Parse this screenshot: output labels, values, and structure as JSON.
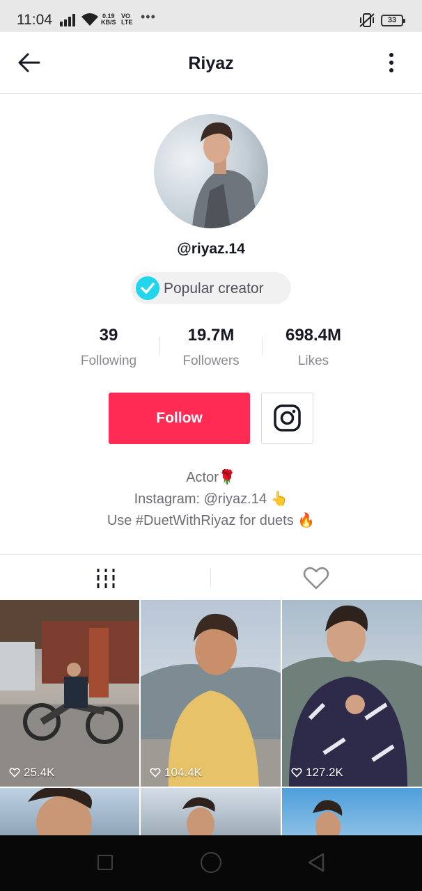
{
  "status_bar": {
    "time": "11:04",
    "speed_value": "0.19",
    "speed_unit": "KB/S",
    "volte_top": "VO",
    "volte_bottom": "LTE",
    "overflow": "•••",
    "battery": "33",
    "icons": [
      "signal-icon",
      "wifi-icon",
      "vibrate-icon",
      "battery-icon"
    ]
  },
  "header": {
    "title": "Riyaz",
    "icons": [
      "back-arrow-icon",
      "more-vertical-icon"
    ]
  },
  "profile": {
    "username": "@riyaz.14",
    "badge_label": "Popular creator",
    "stats": [
      {
        "value": "39",
        "label": "Following"
      },
      {
        "value": "19.7M",
        "label": "Followers"
      },
      {
        "value": "698.4M",
        "label": "Likes"
      }
    ],
    "follow_label": "Follow",
    "bio_lines": [
      {
        "text": "Actor",
        "emoji": "🌹"
      },
      {
        "text": "Instagram: @riyaz.14",
        "emoji": "👆"
      },
      {
        "text": "Use #DuetWithRiyaz for duets",
        "emoji": "🔥"
      }
    ]
  },
  "tabs": {
    "icons": [
      "videos-grid-icon",
      "liked-heart-icon"
    ]
  },
  "videos": [
    {
      "views": "25.4K"
    },
    {
      "views": "104.4K"
    },
    {
      "views": "127.2K"
    },
    {
      "views": ""
    },
    {
      "views": ""
    },
    {
      "views": ""
    }
  ],
  "colors": {
    "accent": "#fe2c55",
    "verified": "#20d5ec",
    "text_primary": "#161823",
    "text_secondary": "#8a8b91"
  }
}
